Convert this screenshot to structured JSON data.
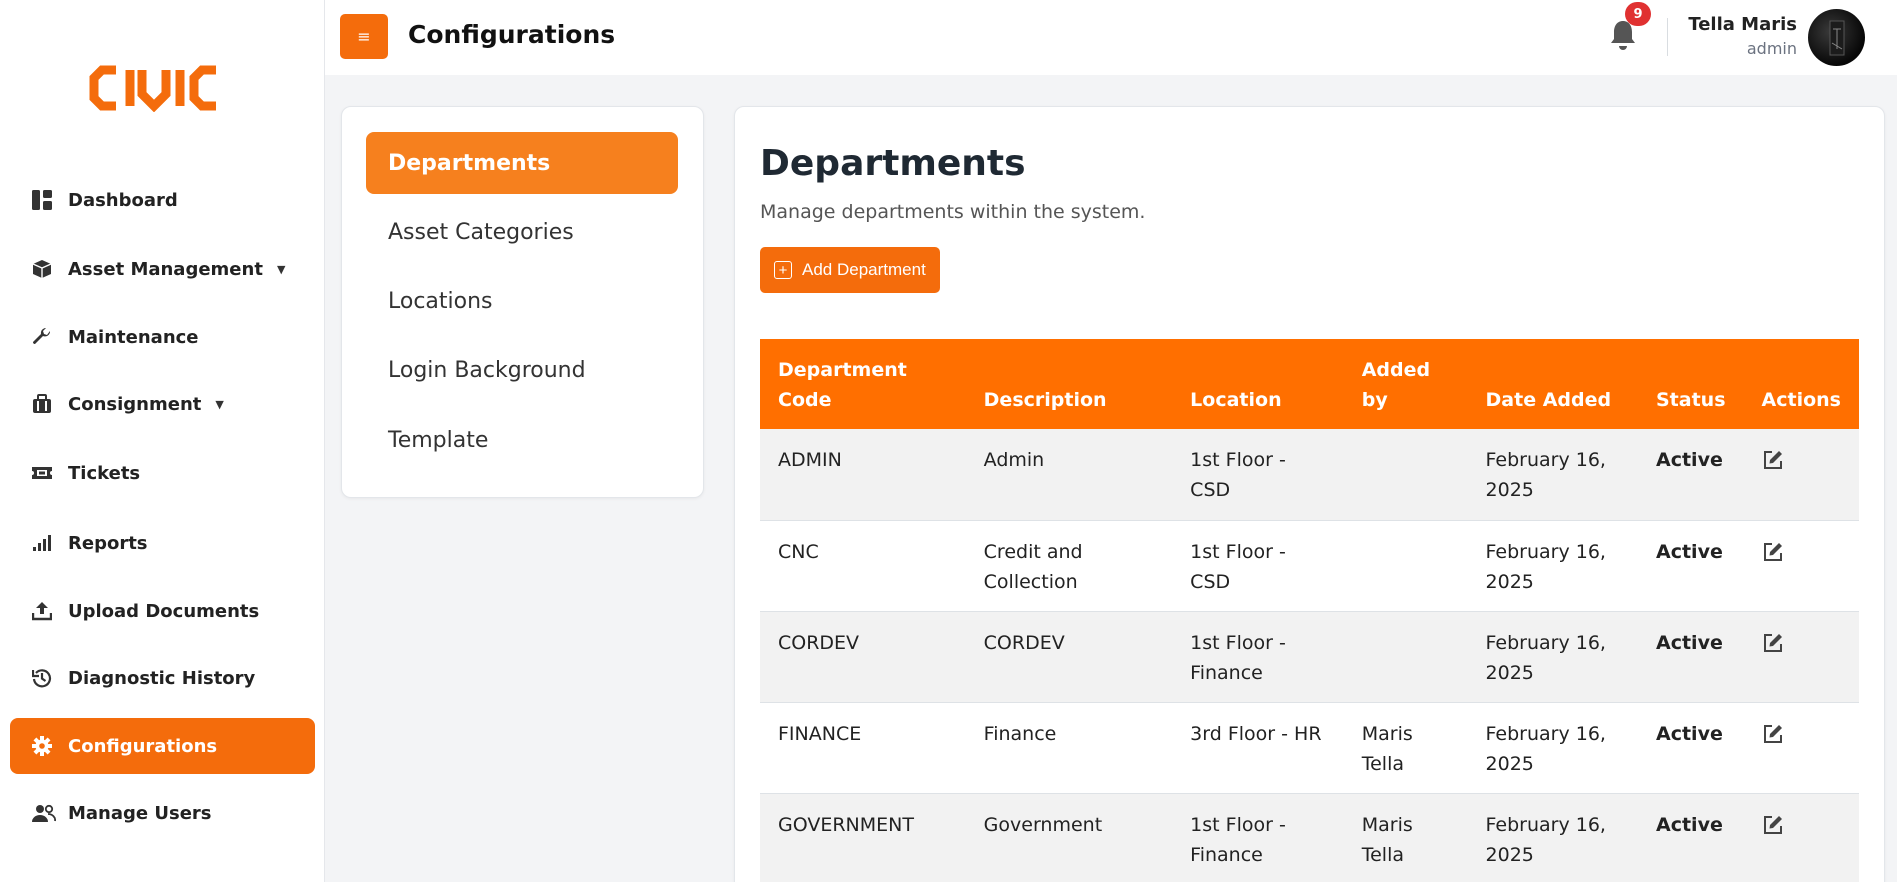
{
  "brand": {
    "logo_text": "CIVIC",
    "accent": "#f46c0c"
  },
  "sidebar": {
    "items": [
      {
        "label": "Dashboard",
        "icon": "dashboard-icon"
      },
      {
        "label": "Asset Management",
        "icon": "box-icon",
        "has_caret": true
      },
      {
        "label": "Maintenance",
        "icon": "wrench-icon"
      },
      {
        "label": "Consignment",
        "icon": "briefcase-icon",
        "has_caret": true
      },
      {
        "label": "Tickets",
        "icon": "ticket-icon"
      },
      {
        "label": "Reports",
        "icon": "bar-chart-icon"
      },
      {
        "label": "Upload Documents",
        "icon": "upload-icon"
      },
      {
        "label": "Diagnostic History",
        "icon": "history-icon"
      },
      {
        "label": "Configurations",
        "icon": "gear-icon",
        "active": true
      },
      {
        "label": "Manage Users",
        "icon": "users-icon"
      }
    ]
  },
  "header": {
    "menu_icon": "≡",
    "title": "Configurations",
    "notifications": {
      "count": "9"
    },
    "user": {
      "name": "Tella Maris",
      "role": "admin"
    }
  },
  "config_menu": {
    "items": [
      {
        "label": "Departments",
        "active": true
      },
      {
        "label": "Asset Categories"
      },
      {
        "label": "Locations"
      },
      {
        "label": "Login Background"
      },
      {
        "label": "Template"
      }
    ]
  },
  "main": {
    "title": "Departments",
    "subtitle": "Manage departments within the system.",
    "add_button": "Add Department",
    "table": {
      "headers": [
        "Department Code",
        "Description",
        "Location",
        "Added by",
        "Date Added",
        "Status",
        "Actions"
      ],
      "rows": [
        {
          "code": "ADMIN",
          "description": "Admin",
          "location": "1st Floor - CSD",
          "added_by": "",
          "date_added": "February 16, 2025",
          "status": "Active"
        },
        {
          "code": "CNC",
          "description": "Credit and Collection",
          "location": "1st Floor - CSD",
          "added_by": "",
          "date_added": "February 16, 2025",
          "status": "Active"
        },
        {
          "code": "CORDEV",
          "description": "CORDEV",
          "location": "1st Floor - Finance",
          "added_by": "",
          "date_added": "February 16, 2025",
          "status": "Active"
        },
        {
          "code": "FINANCE",
          "description": "Finance",
          "location": "3rd Floor - HR",
          "added_by": "Maris Tella",
          "date_added": "February 16, 2025",
          "status": "Active"
        },
        {
          "code": "GOVERNMENT",
          "description": "Government",
          "location": "1st Floor - Finance",
          "added_by": "Maris Tella",
          "date_added": "February 16, 2025",
          "status": "Active"
        }
      ]
    }
  }
}
